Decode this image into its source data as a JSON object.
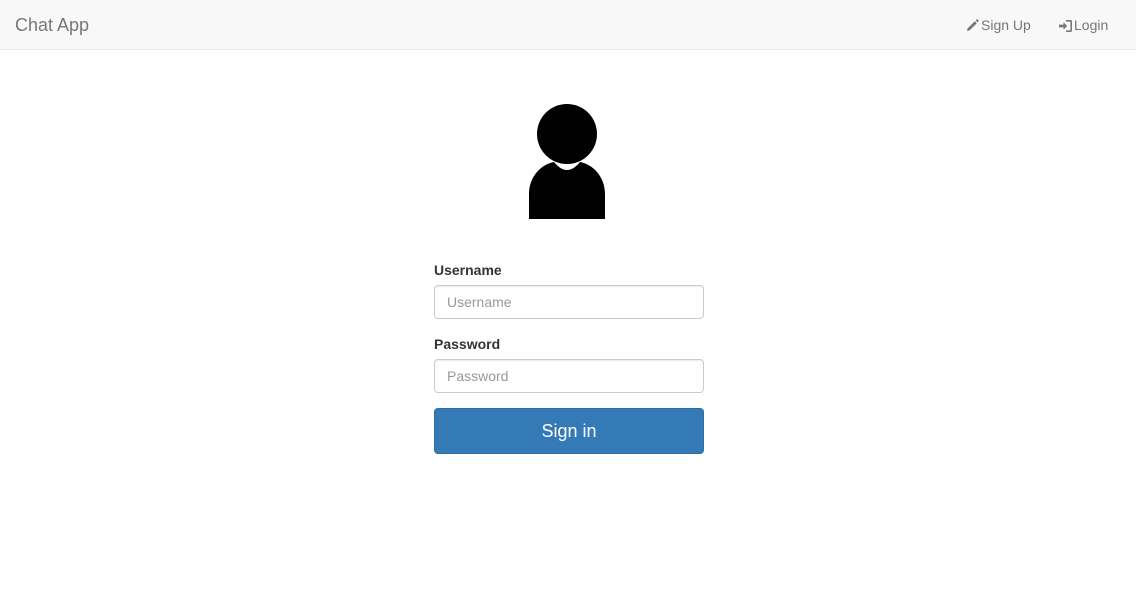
{
  "navbar": {
    "brand": "Chat App",
    "signup": {
      "label": "Sign Up",
      "icon": "pencil-icon"
    },
    "login": {
      "label": "Login",
      "icon": "log-in-icon"
    }
  },
  "avatar": {
    "icon": "user-silhouette-icon"
  },
  "form": {
    "username": {
      "label": "Username",
      "placeholder": "Username",
      "value": ""
    },
    "password": {
      "label": "Password",
      "placeholder": "Password",
      "value": ""
    },
    "submit_label": "Sign in"
  },
  "colors": {
    "navbar_bg": "#f8f8f8",
    "nav_text": "#777777",
    "primary": "#337ab7",
    "primary_border": "#2e6da4"
  }
}
